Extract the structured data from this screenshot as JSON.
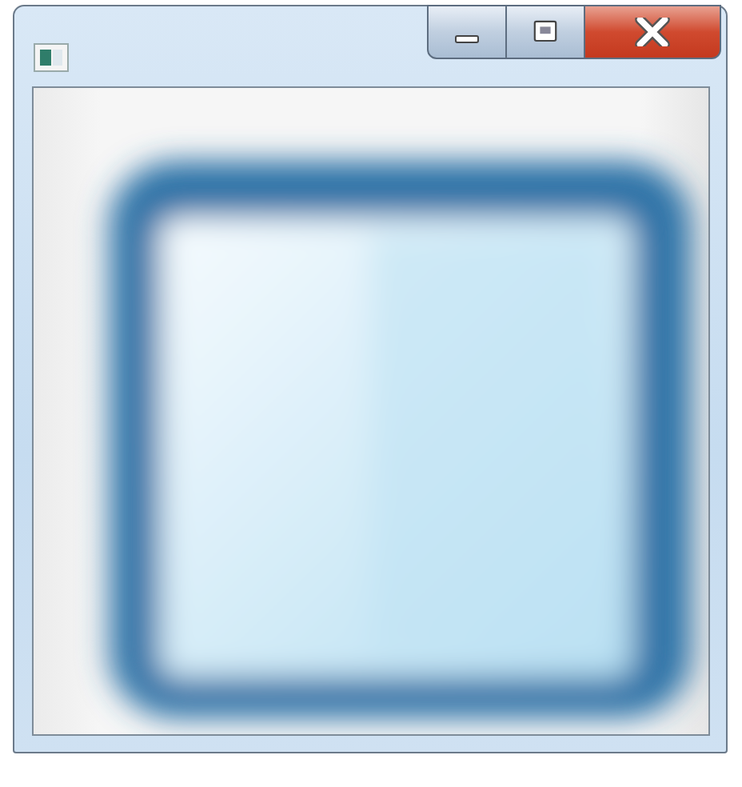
{
  "window": {
    "caption_buttons": [
      {
        "kind": "minimize"
      },
      {
        "kind": "maximize"
      },
      {
        "kind": "close"
      }
    ]
  }
}
